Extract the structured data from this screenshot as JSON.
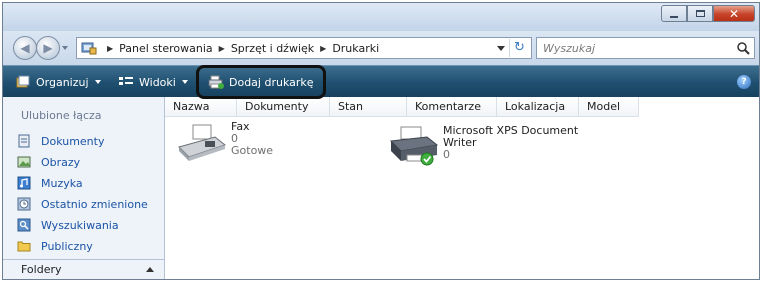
{
  "address": {
    "crumbs": [
      "Panel sterowania",
      "Sprzęt i dźwięk",
      "Drukarki"
    ]
  },
  "search": {
    "placeholder": "Wyszukaj"
  },
  "toolbar": {
    "organize_label": "Organizuj",
    "views_label": "Widoki",
    "add_printer_label": "Dodaj drukarkę",
    "help_label": "?"
  },
  "navpane": {
    "heading": "Ulubione łącza",
    "items": [
      {
        "label": "Dokumenty",
        "icon": "documents-icon"
      },
      {
        "label": "Obrazy",
        "icon": "pictures-icon"
      },
      {
        "label": "Muzyka",
        "icon": "music-icon"
      },
      {
        "label": "Ostatnio zmienione",
        "icon": "recent-icon"
      },
      {
        "label": "Wyszukiwania",
        "icon": "searches-icon"
      },
      {
        "label": "Publiczny",
        "icon": "public-folder-icon"
      }
    ],
    "folders_label": "Foldery"
  },
  "columns": [
    "Nazwa",
    "Dokumenty",
    "Stan",
    "Komentarze",
    "Lokalizacja",
    "Model"
  ],
  "printers": [
    {
      "name_line1": "Fax",
      "name_line2": "",
      "documents": "0",
      "status": "Gotowe",
      "icon": "fax-icon"
    },
    {
      "name_line1": "Microsoft XPS Document",
      "name_line2": "Writer",
      "documents": "0",
      "status": "",
      "icon": "xps-printer-default-icon"
    }
  ],
  "colors": {
    "command_bar": "#1f4f70",
    "link_blue": "#1b53a5",
    "nav_bg": "#eef3fa"
  }
}
